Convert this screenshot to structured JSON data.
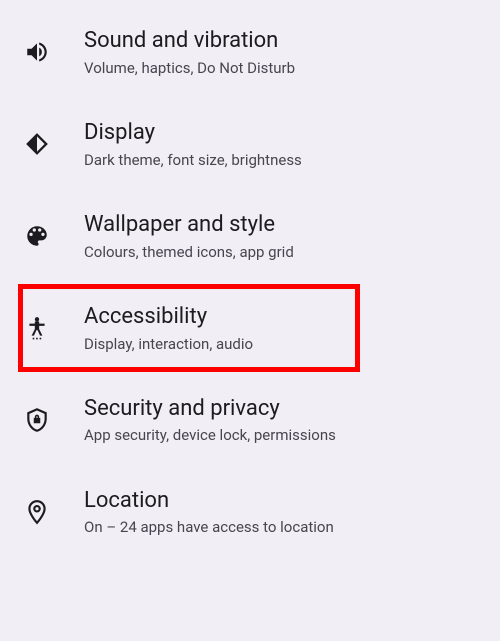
{
  "settings": {
    "items": [
      {
        "title": "Sound and vibration",
        "subtitle": "Volume, haptics, Do Not Disturb",
        "icon": "sound",
        "highlighted": false
      },
      {
        "title": "Display",
        "subtitle": "Dark theme, font size, brightness",
        "icon": "display",
        "highlighted": false
      },
      {
        "title": "Wallpaper and style",
        "subtitle": "Colours, themed icons, app grid",
        "icon": "wallpaper",
        "highlighted": false
      },
      {
        "title": "Accessibility",
        "subtitle": "Display, interaction, audio",
        "icon": "accessibility",
        "highlighted": true
      },
      {
        "title": "Security and privacy",
        "subtitle": "App security, device lock, permissions",
        "icon": "security",
        "highlighted": false
      },
      {
        "title": "Location",
        "subtitle": "On – 24 apps have access to location",
        "icon": "location",
        "highlighted": false
      }
    ]
  },
  "highlight": {
    "color": "#ff0000"
  }
}
